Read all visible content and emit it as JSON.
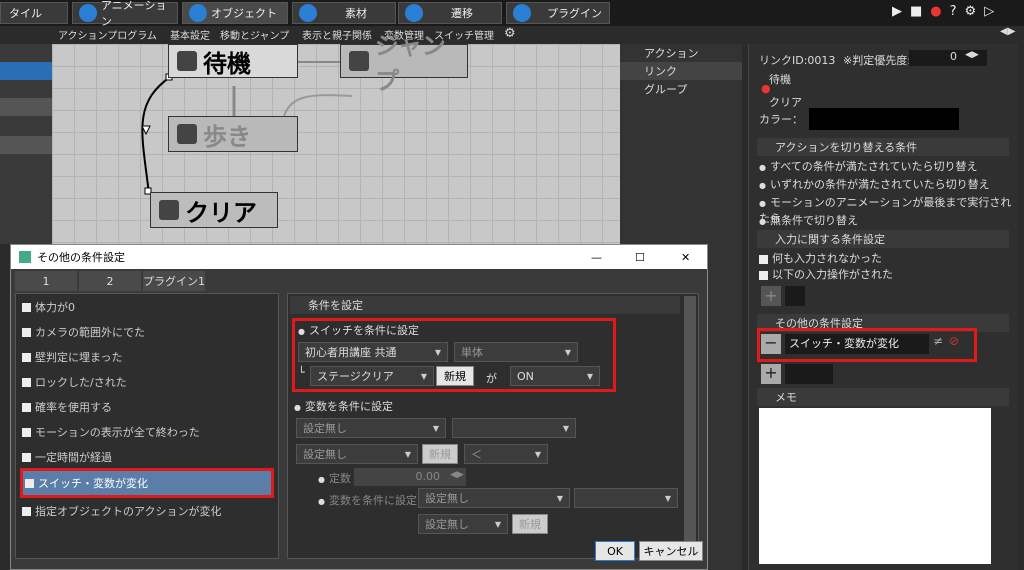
{
  "topbar": {
    "tabs": [
      "タイル",
      "アニメーション",
      "オブジェクト",
      "素材",
      "遷移",
      "プラグイン"
    ]
  },
  "subbar": {
    "items": [
      "アクションプログラム",
      "基本設定",
      "移動とジャンプ",
      "表示と親子関係",
      "変数管理",
      "スイッチ管理"
    ]
  },
  "canvas": {
    "nodes": [
      "待機",
      "ジャンプ",
      "歩き",
      "クリア"
    ]
  },
  "tree": {
    "items": [
      "アクション",
      "リンク",
      "グループ"
    ]
  },
  "right": {
    "link_id": "リンクID:0013",
    "priority_label": "※判定優先度:",
    "priority_value": "0",
    "from": "待機",
    "to": "クリア",
    "color_label": "カラー：",
    "switch_section": "アクションを切り替える条件",
    "switch_options": [
      "すべての条件が満たされていたら切り替え",
      "いずれかの条件が満たされていたら切り替え",
      "モーションのアニメーションが最後まで実行されたら",
      "無条件で切り替え"
    ],
    "input_section": "入力に関する条件設定",
    "input_options": [
      "何も入力されなかった",
      "以下の入力操作がされた"
    ],
    "other_section": "その他の条件設定",
    "other_item": "スイッチ・変数が変化",
    "memo": "メモ"
  },
  "dialog": {
    "title": "その他の条件設定",
    "tabs": [
      "1",
      "2",
      "プラグイン1"
    ],
    "list": [
      "体力が0",
      "カメラの範囲外にでた",
      "壁判定に埋まった",
      "ロックした/された",
      "確率を使用する",
      "モーションの表示が全て終わった",
      "一定時間が経過",
      "スイッチ・変数が変化",
      "指定オブジェクトのアクションが変化"
    ],
    "cond_header": "条件を設定",
    "switch_radio": "スイッチを条件に設定",
    "switch_select1": "初心者用講座 共通",
    "switch_select2": "単体",
    "switch_select3": "ステージクリア",
    "new_label": "新規",
    "ga": "が",
    "switch_value": "ON",
    "var_radio": "変数を条件に設定",
    "none1": "設定無し",
    "none2": "設定無し",
    "op": "＜",
    "const": "定数",
    "const_value": "0.00",
    "var_cond": "変数を条件に設定",
    "none3": "設定無し",
    "none4": "設定無し",
    "ok": "OK",
    "cancel": "キャンセル"
  }
}
